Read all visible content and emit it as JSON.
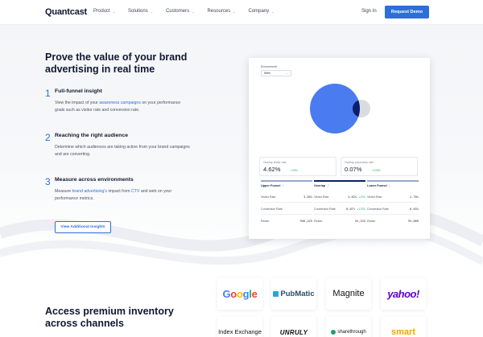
{
  "nav": {
    "logo": "Quantcast",
    "menu": [
      {
        "label": "Product"
      },
      {
        "label": "Solutions"
      },
      {
        "label": "Customers"
      },
      {
        "label": "Resources"
      },
      {
        "label": "Company"
      }
    ],
    "sign_in": "Sign In",
    "cta": "Request Demo"
  },
  "hero": {
    "headline": "Prove the value of your brand advertising in real time",
    "steps": [
      {
        "num": "1",
        "title": "Full-funnel insight",
        "body_pre": "View the impact of your ",
        "body_link": "awareness campaigns",
        "body_post": " on your performance goals such as visitor rate and conversion rate."
      },
      {
        "num": "2",
        "title": "Reaching the right audience",
        "body": "Determine which audiences are taking action from your brand campaigns and are converting."
      },
      {
        "num": "3",
        "title": "Measure across environments",
        "body_pre": "Measure ",
        "body_link": "brand advertising's",
        "body_mid": " impact from ",
        "body_link2": "CTV",
        "body_post": " and web on your performance metrics."
      }
    ],
    "button": "View Additional Insights"
  },
  "dashboard": {
    "env_label": "Environment",
    "env_value": "Web",
    "stats": [
      {
        "label": "Overlap visitor rate",
        "value": "4.62%",
        "delta": "+19%"
      },
      {
        "label": "Overlap conversion rate",
        "value": "0.07%",
        "delta": "+133%"
      }
    ],
    "funnels": [
      {
        "title": "Upper Funnel",
        "rows": [
          {
            "label": "Visitor Rate",
            "value": "3.85%",
            "delta": ""
          },
          {
            "label": "Conversion Rate",
            "value": "",
            "delta": ""
          },
          {
            "label": "Reach",
            "value": "956,425",
            "delta": ""
          }
        ]
      },
      {
        "title": "Overlap",
        "rows": [
          {
            "label": "Visitor Rate",
            "value": "4.62%",
            "delta": "+19%"
          },
          {
            "label": "Conversion Rate",
            "value": "0.07%",
            "delta": "+133%"
          },
          {
            "label": "Reach",
            "value": "54,333",
            "delta": ""
          }
        ]
      },
      {
        "title": "Lower Funnel",
        "rows": [
          {
            "label": "Visitor Rate",
            "value": "2.70%",
            "delta": ""
          },
          {
            "label": "Conversion Rate",
            "value": "0.03%",
            "delta": ""
          },
          {
            "label": "Reach",
            "value": "93,089",
            "delta": ""
          }
        ]
      }
    ],
    "venn_colors": {
      "upper": "#4a7cf0",
      "lower": "#d9dbe1",
      "overlap": "#0b1f6e"
    }
  },
  "inventory": {
    "title": "Access premium inventory across channels",
    "partners": [
      "Google",
      "PubMatic",
      "Magnite",
      "yahoo!",
      "Index Exchange",
      "UNRULY",
      "sharethrough",
      "smart"
    ]
  }
}
